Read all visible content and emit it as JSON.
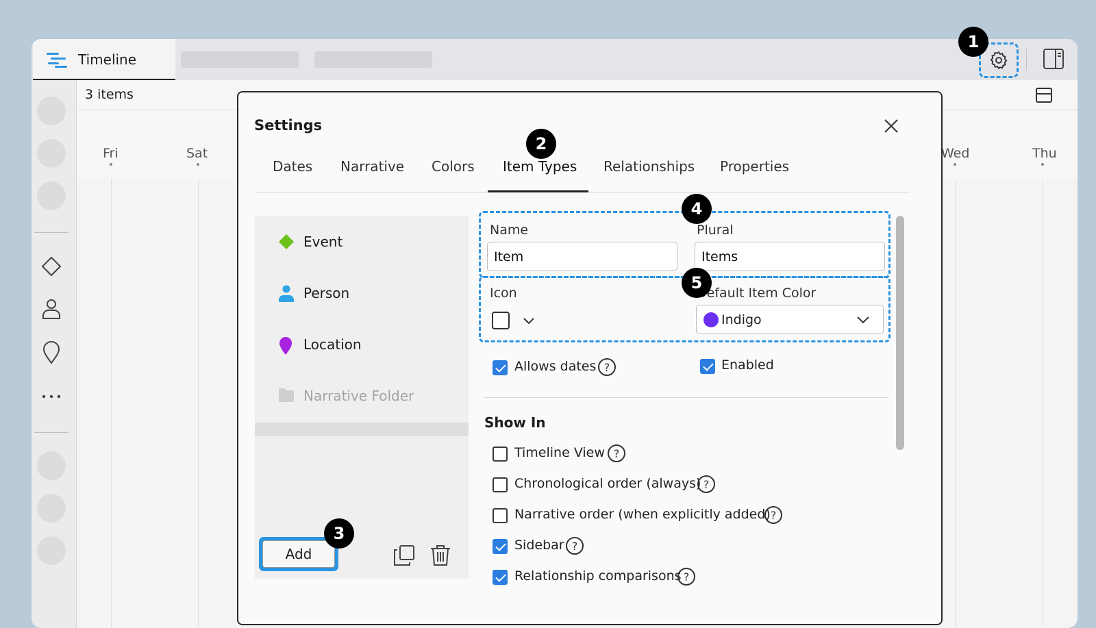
{
  "app": {
    "tab_title": "Timeline",
    "item_count": "3 items",
    "days": [
      "Fri",
      "Sat",
      "Wed",
      "Thu"
    ]
  },
  "dialog": {
    "title": "Settings",
    "tabs": [
      {
        "label": "Dates"
      },
      {
        "label": "Narrative"
      },
      {
        "label": "Colors"
      },
      {
        "label": "Item Types",
        "active": true
      },
      {
        "label": "Relationships"
      },
      {
        "label": "Properties"
      }
    ],
    "item_types": [
      {
        "label": "Event",
        "icon": "diamond-icon",
        "color": "#6cc21a"
      },
      {
        "label": "Person",
        "icon": "person-icon",
        "color": "#2fa4e7"
      },
      {
        "label": "Location",
        "icon": "pin-icon",
        "color": "#a823e0"
      },
      {
        "label": "Narrative Folder",
        "icon": "folder-icon",
        "disabled": true
      }
    ],
    "add_label": "Add",
    "form": {
      "name_label": "Name",
      "name_value": "Item",
      "plural_label": "Plural",
      "plural_value": "Items",
      "icon_label": "Icon",
      "color_label": "Default Item Color",
      "color_value": "Indigo",
      "color_hex": "#6a2ff0",
      "allows_dates_label": "Allows dates",
      "allows_dates": true,
      "enabled_label": "Enabled",
      "enabled": true,
      "show_in_title": "Show In",
      "show_in": [
        {
          "label": "Timeline View",
          "checked": false
        },
        {
          "label": "Chronological order (always)",
          "checked": false
        },
        {
          "label": "Narrative order (when explicitly added)",
          "checked": false
        },
        {
          "label": "Sidebar",
          "checked": true
        },
        {
          "label": "Relationship comparisons",
          "checked": true
        }
      ]
    }
  },
  "badges": [
    "1",
    "2",
    "3",
    "4",
    "5"
  ],
  "colors": {
    "accent": "#2b93e0",
    "check": "#2b7de0"
  }
}
